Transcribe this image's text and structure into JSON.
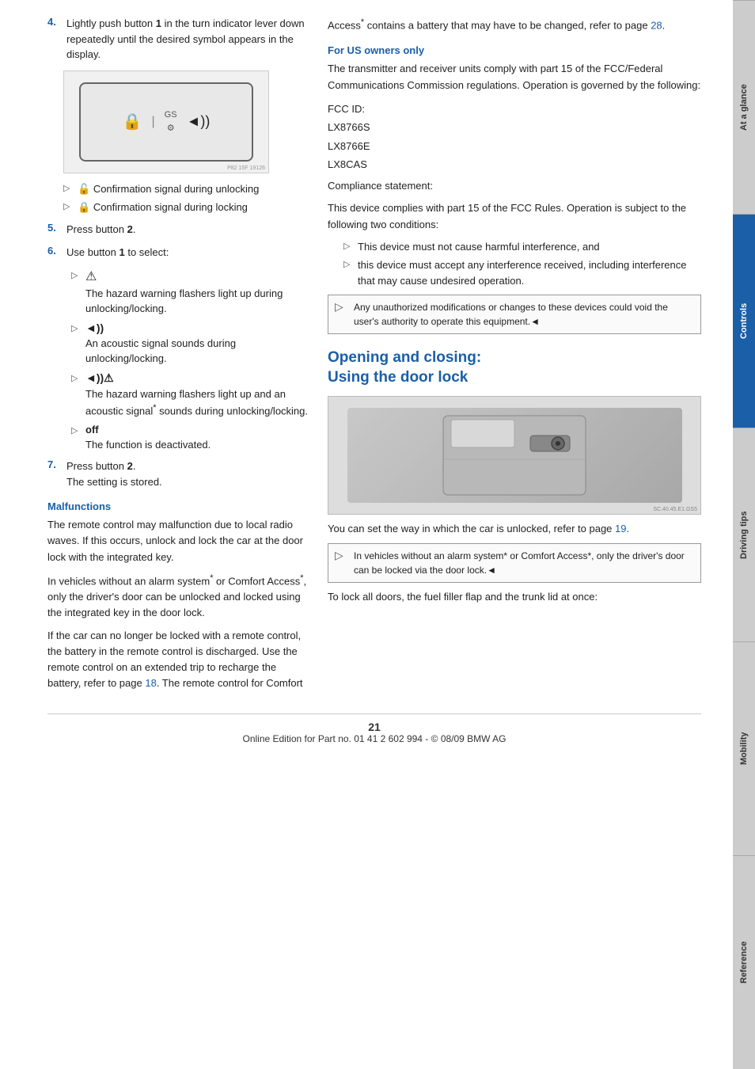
{
  "page": {
    "number": "21",
    "footer": "Online Edition for Part no. 01 41 2 602 994 - © 08/09 BMW AG"
  },
  "side_tabs": [
    {
      "id": "at-a-glance",
      "label": "At a glance",
      "active": false
    },
    {
      "id": "controls",
      "label": "Controls",
      "active": true
    },
    {
      "id": "driving-tips",
      "label": "Driving tips",
      "active": false
    },
    {
      "id": "mobility",
      "label": "Mobility",
      "active": false
    },
    {
      "id": "reference",
      "label": "Reference",
      "active": false
    }
  ],
  "left_column": {
    "step4": {
      "num": "4.",
      "text": "Lightly push button 1 in the turn indicator lever down repeatedly until the desired symbol appears in the display."
    },
    "cluster_image_alt": "Instrument cluster display showing turn indicator symbols",
    "cluster_watermark": "P82 15F 19126",
    "bullet_unlock": "Confirmation signal during unlocking",
    "bullet_lock": "Confirmation signal during locking",
    "step5": {
      "num": "5.",
      "text": "Press button 2."
    },
    "step6": {
      "num": "6.",
      "text": "Use button 1 to select:"
    },
    "sub_items": [
      {
        "icon": "⚠",
        "description": "The hazard warning flashers light up during unlocking/locking."
      },
      {
        "icon": "◄))",
        "description": "An acoustic signal sounds during unlocking/locking."
      },
      {
        "icon": "◄))⚠",
        "description": "The hazard warning flashers light up and an acoustic signal* sounds during unlocking/locking."
      },
      {
        "icon": "off",
        "description": "The function is deactivated."
      }
    ],
    "step7": {
      "num": "7.",
      "text": "Press button 2.",
      "subtext": "The setting is stored."
    },
    "malfunctions": {
      "heading": "Malfunctions",
      "para1": "The remote control may malfunction due to local radio waves. If this occurs, unlock and lock the car at the door lock with the integrated key.",
      "para2": "In vehicles without an alarm system* or Comfort Access*, only the driver's door can be unlocked and locked using the integrated key in the door lock.",
      "para3": "If the car can no longer be locked with a remote control, the battery in the remote control is discharged. Use the remote control on an extended trip to recharge the battery, refer to page 18. The remote control for Comfort"
    }
  },
  "right_column": {
    "access_note": "Access* contains a battery that may have to be changed, refer to page 28.",
    "for_us_owners": {
      "heading": "For US owners only",
      "para1": "The transmitter and receiver units comply with part 15 of the FCC/Federal Communications Commission regulations. Operation is governed by the following:",
      "fcc_id_label": "FCC ID:",
      "fcc_ids": [
        "LX8766S",
        "LX8766E",
        "LX8CAS"
      ],
      "compliance_label": "Compliance statement:",
      "compliance_text": "This device complies with part 15 of the FCC Rules. Operation is subject to the following two conditions:",
      "conditions": [
        "This device must not cause harmful interference, and",
        "this device must accept any interference received, including interference that may cause undesired operation."
      ],
      "note_text": "Any unauthorized modifications or changes to these devices could void the user's authority to operate this equipment.◄"
    },
    "opening_closing": {
      "heading": "Opening and closing:\nUsing the door lock",
      "door_image_alt": "Door lock cylinder",
      "door_image_watermark": "SC.40.45.E1.GS5",
      "para1": "You can set the way in which the car is unlocked, refer to page 19.",
      "note_text": "In vehicles without an alarm system* or Comfort Access*, only the driver's door can be locked via the door lock.◄",
      "para2": "To lock all doors, the fuel filler flap and the trunk lid at once:"
    }
  }
}
